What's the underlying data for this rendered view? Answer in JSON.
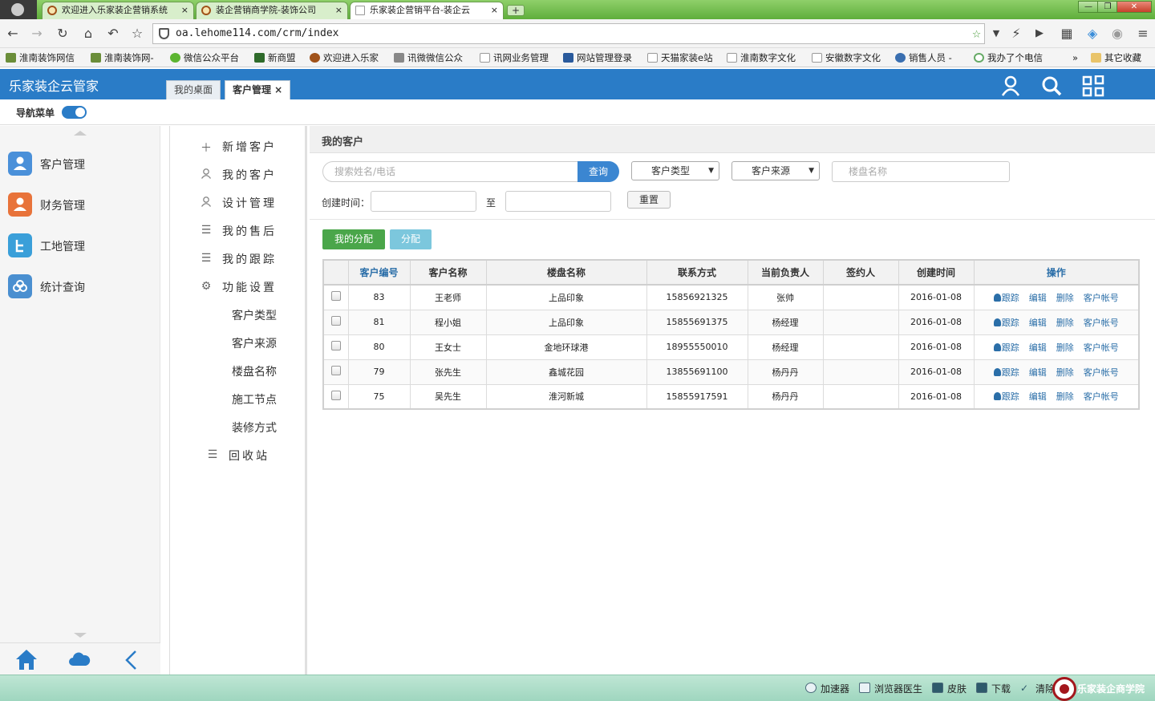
{
  "browser": {
    "tabs": [
      {
        "title": "欢迎进入乐家装企营销系统"
      },
      {
        "title": "装企营销商学院-装饰公司"
      },
      {
        "title": "乐家装企营销平台-装企云"
      }
    ],
    "tab_close": "×",
    "new_tab": "+",
    "url": "oa.lehome114.com/crm/index",
    "bookmarks": [
      "淮南装饰网信",
      "淮南装饰网-",
      "微信公众平台",
      "新商盟",
      "欢迎进入乐家",
      "讯微微信公众",
      "讯网业务管理",
      "网站管理登录",
      "天猫家装e站",
      "淮南数字文化",
      "安徽数字文化",
      "销售人员 -",
      "我办了个电信"
    ],
    "bookmarks_more": "»",
    "other_bookmarks": "其它收藏"
  },
  "app": {
    "title": "乐家装企云管家",
    "tabs": [
      {
        "label": "我的桌面"
      },
      {
        "label": "客户管理 ×"
      }
    ],
    "nav_menu_label": "导航菜单"
  },
  "sidebar": {
    "items": [
      {
        "label": "客户管理",
        "color": "#4a90d9"
      },
      {
        "label": "财务管理",
        "color": "#e8733a"
      },
      {
        "label": "工地管理",
        "color": "#3a9fd9"
      },
      {
        "label": "统计查询",
        "color": "#4a8fd0"
      }
    ]
  },
  "submenu": {
    "items": [
      {
        "label": "新增客户",
        "icon": "plus-icon"
      },
      {
        "label": "我的客户",
        "icon": "user-icon"
      },
      {
        "label": "设计管理",
        "icon": "user-icon"
      },
      {
        "label": "我的售后",
        "icon": "list-icon"
      },
      {
        "label": "我的跟踪",
        "icon": "list-icon"
      },
      {
        "label": "功能设置",
        "icon": "gear-icon"
      }
    ],
    "settings": [
      "客户类型",
      "客户来源",
      "楼盘名称",
      "施工节点",
      "装修方式"
    ],
    "recycle": "回收站"
  },
  "main": {
    "panel_title": "我的客户",
    "search_placeholder": "搜索姓名/电话",
    "search_button": "查询",
    "customer_type": "客户类型",
    "customer_source": "客户来源",
    "building_placeholder": "楼盘名称",
    "created_label": "创建时间：",
    "to_label": "至",
    "reset_button": "重置",
    "my_assign_button": "我的分配",
    "assign_button": "分配",
    "columns": [
      "客户编号",
      "客户名称",
      "楼盘名称",
      "联系方式",
      "当前负责人",
      "签约人",
      "创建时间",
      "操作"
    ],
    "rows": [
      {
        "id": "83",
        "name": "王老师",
        "building": "上品印象",
        "phone": "15856921325",
        "owner": "张帅",
        "signer": "",
        "created": "2016-01-08"
      },
      {
        "id": "81",
        "name": "程小姐",
        "building": "上品印象",
        "phone": "15855691375",
        "owner": "杨经理",
        "signer": "",
        "created": "2016-01-08"
      },
      {
        "id": "80",
        "name": "王女士",
        "building": "金地环球港",
        "phone": "18955550010",
        "owner": "杨经理",
        "signer": "",
        "created": "2016-01-08"
      },
      {
        "id": "79",
        "name": "张先生",
        "building": "鑫城花园",
        "phone": "13855691100",
        "owner": "杨丹丹",
        "signer": "",
        "created": "2016-01-08"
      },
      {
        "id": "75",
        "name": "吴先生",
        "building": "淮河新城",
        "phone": "15855917591",
        "owner": "杨丹丹",
        "signer": "",
        "created": "2016-01-08"
      }
    ],
    "ops": [
      "跟踪",
      "编辑",
      "删除",
      "客户帐号"
    ]
  },
  "statusbar": {
    "items": [
      "加速器",
      "浏览器医生",
      "皮肤",
      "下载",
      "清除"
    ],
    "brand": "乐家装企商学院"
  }
}
